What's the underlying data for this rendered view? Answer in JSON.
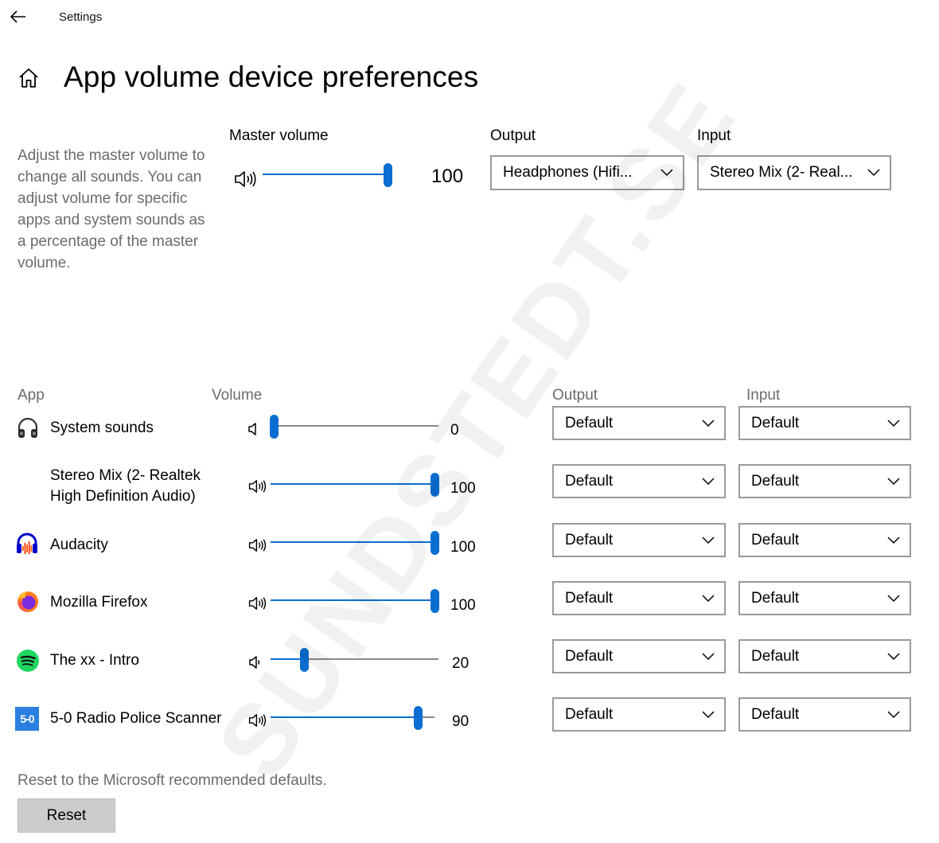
{
  "window": {
    "title": "Settings"
  },
  "page": {
    "title": "App volume  device preferences"
  },
  "description": "Adjust the master volume to change all sounds. You can adjust volume for specific apps and system sounds as a percentage of the master volume.",
  "master": {
    "label": "Master volume",
    "value": 100,
    "value_text": "100",
    "output_label": "Output",
    "output_value": "Headphones (Hifi...",
    "input_label": "Input",
    "input_value": "Stereo Mix (2- Real..."
  },
  "table": {
    "headers": {
      "app": "App",
      "volume": "Volume",
      "output": "Output",
      "input": "Input"
    },
    "rows": [
      {
        "name": "System sounds",
        "icon": "headphones-icon",
        "volume": 0,
        "volume_text": "0",
        "output": "Default",
        "input": "Default"
      },
      {
        "name": "Stereo Mix (2- Realtek High Definition Audio)",
        "icon": "",
        "volume": 100,
        "volume_text": "100",
        "output": "Default",
        "input": "Default"
      },
      {
        "name": "Audacity",
        "icon": "audacity-icon",
        "volume": 100,
        "volume_text": "100",
        "output": "Default",
        "input": "Default"
      },
      {
        "name": "Mozilla Firefox",
        "icon": "firefox-icon",
        "volume": 100,
        "volume_text": "100",
        "output": "Default",
        "input": "Default"
      },
      {
        "name": "The xx - Intro",
        "icon": "spotify-icon",
        "volume": 20,
        "volume_text": "20",
        "output": "Default",
        "input": "Default"
      },
      {
        "name": "5-0 Radio Police Scanner",
        "icon": "radio-scanner-icon",
        "volume": 90,
        "volume_text": "90",
        "output": "Default",
        "input": "Default"
      }
    ]
  },
  "reset": {
    "note": "Reset to the Microsoft recommended defaults.",
    "button": "Reset"
  },
  "icons": {
    "scanner_badge": "5-0"
  },
  "watermark": "SUNDSTEDT.SE",
  "colors": {
    "accent": "#0a6dd0",
    "muted_text": "#6b6b6b",
    "button_bg": "#cccccc"
  }
}
